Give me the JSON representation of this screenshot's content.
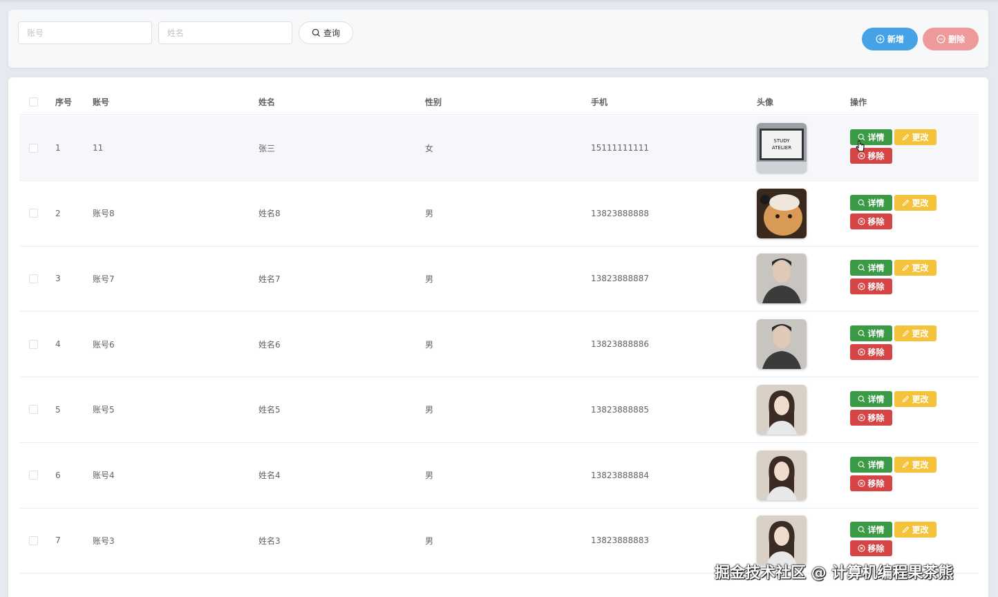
{
  "search": {
    "account_placeholder": "账号",
    "name_placeholder": "姓名",
    "query_label": "查询",
    "add_label": "新增",
    "delete_label": "删除"
  },
  "table": {
    "headers": {
      "index": "序号",
      "account": "账号",
      "name": "姓名",
      "gender": "性别",
      "phone": "手机",
      "avatar": "头像",
      "actions": "操作"
    },
    "actions": {
      "detail": "详情",
      "edit": "更改",
      "remove": "移除"
    },
    "rows": [
      {
        "index": "1",
        "account": "11",
        "name": "张三",
        "gender": "女",
        "phone": "15111111111",
        "avatar": "study-atelier-avatar"
      },
      {
        "index": "2",
        "account": "账号8",
        "name": "姓名8",
        "gender": "男",
        "phone": "13823888888",
        "avatar": "cat-avatar"
      },
      {
        "index": "3",
        "account": "账号7",
        "name": "姓名7",
        "gender": "男",
        "phone": "13823888887",
        "avatar": "man-portrait-avatar"
      },
      {
        "index": "4",
        "account": "账号6",
        "name": "姓名6",
        "gender": "男",
        "phone": "13823888886",
        "avatar": "man-portrait-avatar"
      },
      {
        "index": "5",
        "account": "账号5",
        "name": "姓名5",
        "gender": "男",
        "phone": "13823888885",
        "avatar": "woman-portrait-avatar"
      },
      {
        "index": "6",
        "account": "账号4",
        "name": "姓名4",
        "gender": "男",
        "phone": "13823888884",
        "avatar": "woman-portrait-avatar"
      },
      {
        "index": "7",
        "account": "账号3",
        "name": "姓名3",
        "gender": "男",
        "phone": "13823888883",
        "avatar": "woman-portrait-avatar"
      }
    ]
  },
  "watermark": "掘金技术社区 @ 计算机编程果茶熊",
  "colors": {
    "add": "#46a2e6",
    "delete": "#ee9a9c",
    "detail": "#3b9a45",
    "edit": "#f4c33b",
    "remove": "#d64545"
  }
}
